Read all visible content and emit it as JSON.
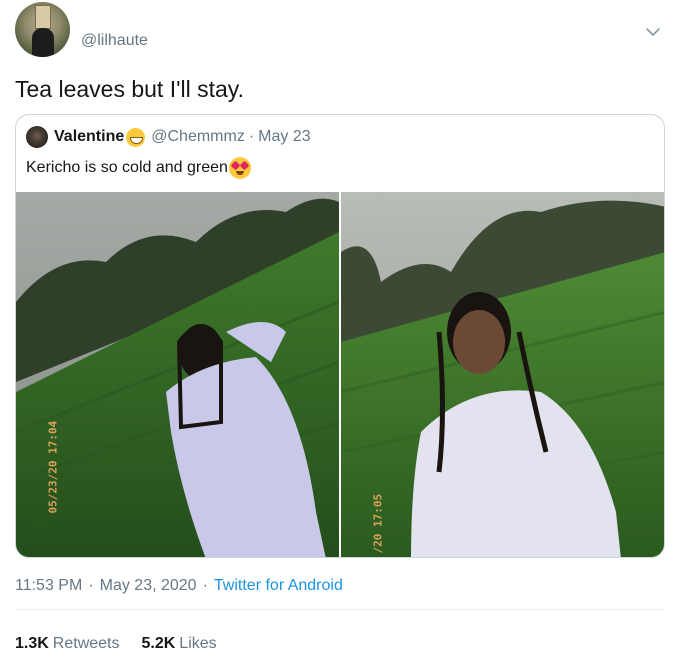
{
  "author": {
    "handle": "@lilhaute",
    "avatar_icon": "profile-avatar-icon"
  },
  "tweet": {
    "text": "Tea leaves but I'll stay."
  },
  "quoted_tweet": {
    "display_name": "Valentine",
    "handle": "@Chemmmz",
    "separator": "·",
    "date": "May 23",
    "text": "Kericho is so cold and green",
    "name_emoji": "grinning-face-emoji",
    "text_emoji": "heart-eyes-emoji",
    "photos": [
      {
        "timestamp": "05/23/20 17:04",
        "description_icon": "photo-woman-tea-field-1"
      },
      {
        "timestamp": "/20 17:05",
        "description_icon": "photo-woman-tea-field-2"
      }
    ]
  },
  "meta": {
    "time": "11:53 PM",
    "separator": "·",
    "date": "May 23, 2020",
    "source": "Twitter for Android"
  },
  "stats": {
    "retweets_count": "1.3K",
    "retweets_label": "Retweets",
    "likes_count": "5.2K",
    "likes_label": "Likes"
  },
  "colors": {
    "text_primary": "#14171a",
    "text_secondary": "#657786",
    "link": "#1b95e0",
    "border": "#ccd6dd"
  }
}
